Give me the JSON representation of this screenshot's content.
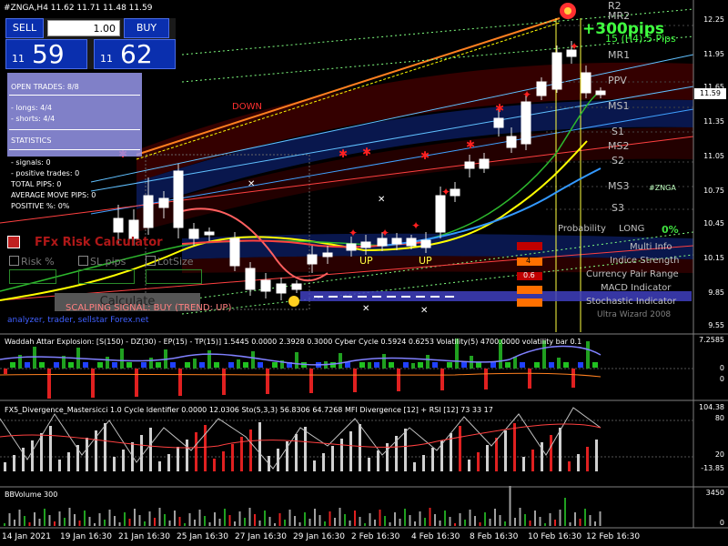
{
  "chart_header": "#ZNGA,H4  11.62 11.71 11.48 11.59",
  "trade_panel": {
    "sell_label": "SELL",
    "buy_label": "BUY",
    "lot_value": "1.00",
    "bid_small": "11",
    "bid_big": "59",
    "ask_small": "11",
    "ask_big": "62"
  },
  "stats_panel": {
    "open_trades": "OPEN TRADES: 8/8",
    "longs": "- longs: 4/4",
    "shorts": "- shorts: 4/4",
    "statistics": "STATISTICS",
    "signals": "- signals: 0",
    "positive_trades": "- positive trades: 0",
    "total_pips": "TOTAL PIPS: 0",
    "average_move": "AVERAGE MOVE PIPS: 0",
    "positive_pct": "POSITIVE %: 0%"
  },
  "risk_calc": {
    "title": "FFx Risk Calculator",
    "risk_label": "Risk %",
    "sl_pips_label": "SL pips",
    "lot_size_label": "LotSize",
    "calculate_label": "Calculate",
    "scalping_signal": "SCALPING SIGNAL:  BUY   (TREND: UP)",
    "watermark": "analyzer, trader, sellstar Forex.net"
  },
  "main_chart_labels": {
    "down": "DOWN",
    "up1": "UP",
    "up2": "UP",
    "pivot_pips": "+300pips",
    "pips_line": "15 (H4):5 Pips",
    "znga": "#ZNGA",
    "probability": "Probability",
    "long": "LONG",
    "pct": "0%",
    "multi_info": "Multi Info",
    "indice_strength": "Indice Strength",
    "currency_pair_range": "Currency Pair Range",
    "macd_indicator": "MACD Indicator",
    "stochastic_indicator": "Stochastic Indicator",
    "ultra_wizard": "Ultra Wizard 2008",
    "box_values": [
      "4",
      "0.6"
    ]
  },
  "pivot_levels": [
    "R2",
    "MR2",
    "MR1",
    "PPV",
    "MS1",
    "S1",
    "MS2",
    "S2",
    "MS3",
    "S3"
  ],
  "price_axis": [
    "12.25",
    "11.95",
    "11.65",
    "11.35",
    "11.05",
    "10.75",
    "10.45",
    "10.15",
    "9.85",
    "9.55"
  ],
  "current_price": "11.59",
  "panels": {
    "waddah": "Waddah Attar Explosion: [S(150) - DZ(30) - EP(15) - TP(15)] 1.5445 0.0000 2.3928 0.3000  Cyber Cycle 0.5924 0.6253  Volatility(5) 4700.0000  volatility bar 0.1",
    "waddah_axis": [
      "7.2585",
      "0",
      "0"
    ],
    "fx_divergence": "FX5_Divergence_Mastersicci 1.0  Cycle Identifier 0.0000 12.0306  Sto(5,3,3) 56.8306 64.7268  MFI Divergence [12] + RSI [12] 73 33 17",
    "fx_axis": [
      "104.38",
      "80",
      "20",
      "-13.85"
    ],
    "bbvolume": "BBVolume 300",
    "bbvolume_axis": [
      "3450",
      "0"
    ]
  },
  "dates": [
    "14 Jan 2021",
    "19 Jan 16:30",
    "21 Jan 16:30",
    "25 Jan 16:30",
    "27 Jan 16:30",
    "29 Jan 16:30",
    "2 Feb 16:30",
    "4 Feb 16:30",
    "8 Feb 16:30",
    "10 Feb 16:30",
    "12 Feb 16:30"
  ],
  "colors": {
    "panel_blue": "#0a2fae",
    "bull_candle": "#ffffff",
    "signal_red": "#ff0000",
    "ma_yellow": "#ffff00",
    "ma_green": "#00c000",
    "grid": "#2a2a2a"
  }
}
